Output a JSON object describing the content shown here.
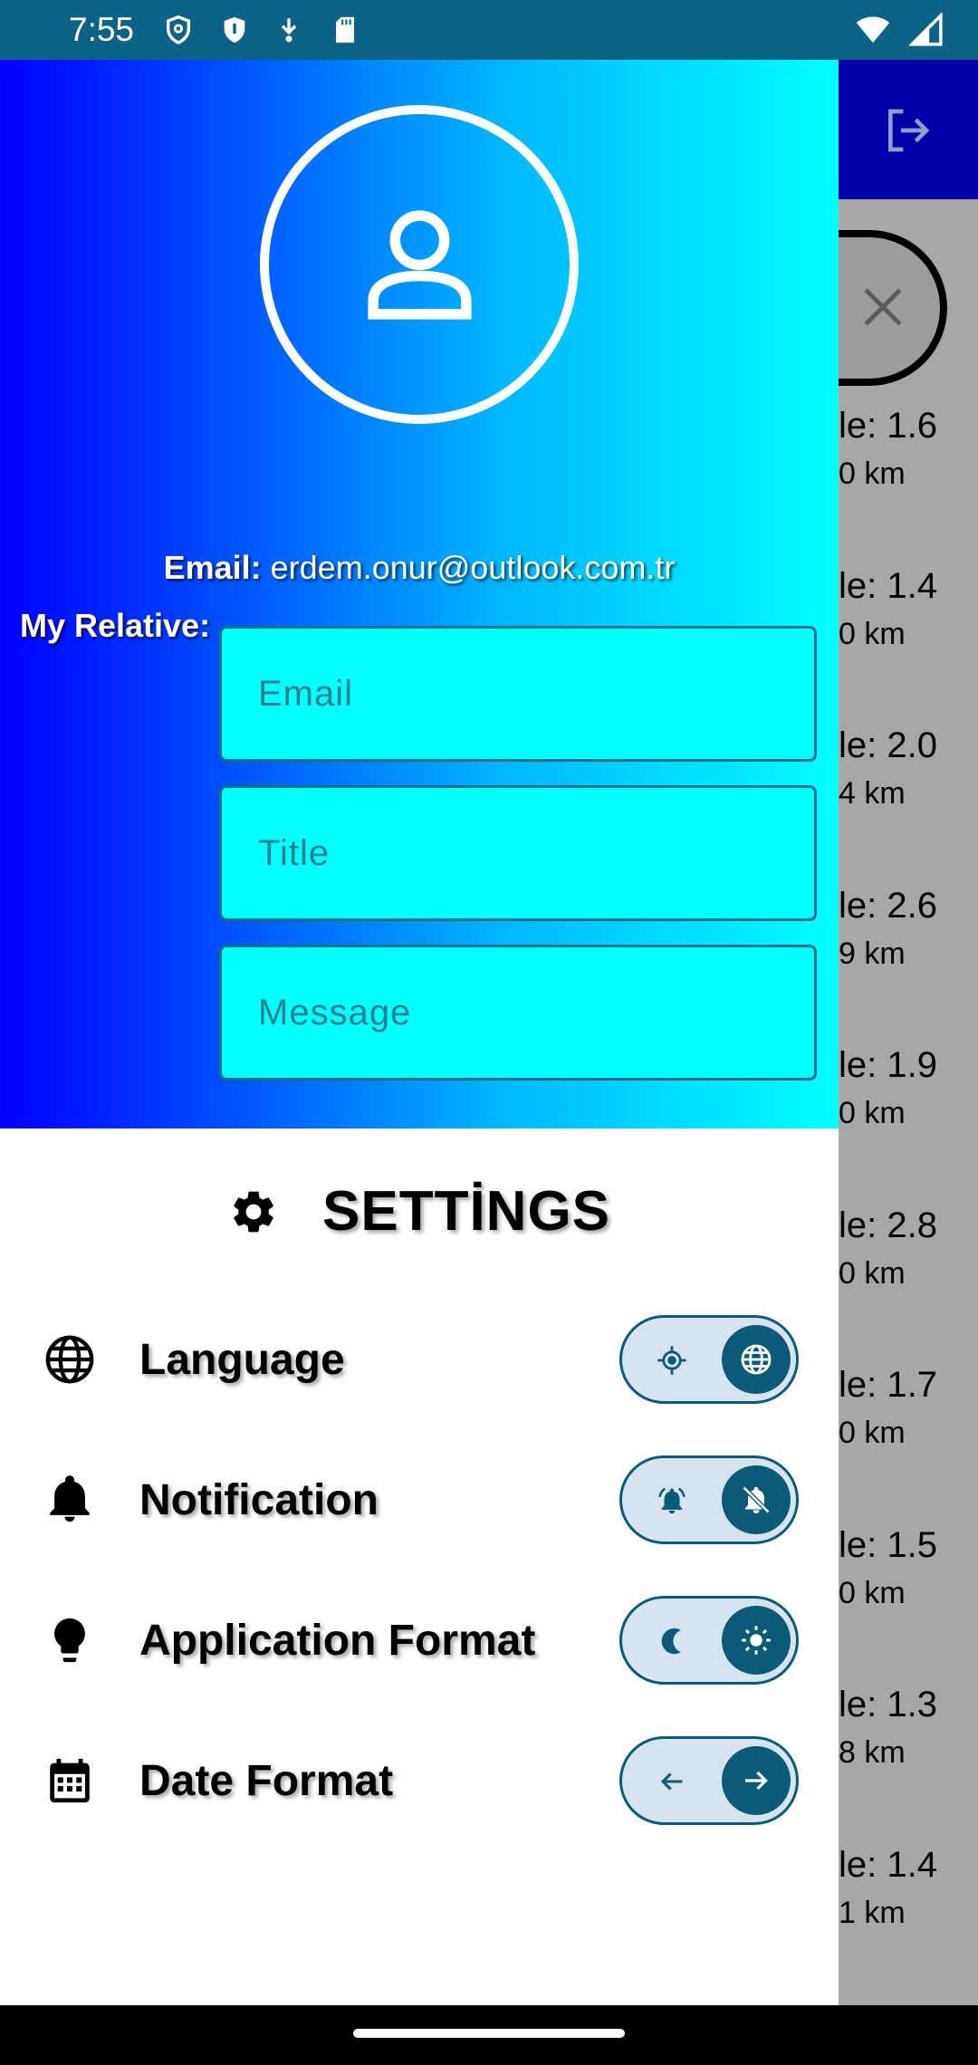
{
  "status_bar": {
    "time": "7:55",
    "icons": [
      "shield-outline-icon",
      "shield-icon",
      "download-icon",
      "sd-card-icon"
    ],
    "right_icons": [
      "wifi-icon",
      "cell-signal-icon"
    ]
  },
  "drawer": {
    "email_label": "Email:",
    "email_value": "erdem.onur@outlook.com.tr",
    "relative_label": "My Relative:",
    "fields": {
      "email_placeholder": "Email",
      "title_placeholder": "Title",
      "message_placeholder": "Message"
    }
  },
  "settings": {
    "title": "SETTİNGS",
    "rows": [
      {
        "label": "Language",
        "icon": "globe-icon",
        "left_icon": "gps-icon",
        "knob_icon": "globe-icon"
      },
      {
        "label": "Notification",
        "icon": "bell-icon",
        "left_icon": "bell-ring-icon",
        "knob_icon": "bell-off-icon"
      },
      {
        "label": "Application Format",
        "icon": "lightbulb-icon",
        "left_icon": "moon-icon",
        "knob_icon": "sun-icon"
      },
      {
        "label": "Date Format",
        "icon": "calendar-icon",
        "left_icon": "arrow-left-icon",
        "knob_icon": "arrow-right-icon"
      }
    ]
  },
  "background_list": {
    "items": [
      {
        "line1": "le: 1.6",
        "line2": "0 km"
      },
      {
        "line1": "le: 1.4",
        "line2": "0 km"
      },
      {
        "line1": "le: 2.0",
        "line2": "4 km"
      },
      {
        "line1": "le: 2.6",
        "line2": "9 km"
      },
      {
        "line1": "le: 1.9",
        "line2": "0 km"
      },
      {
        "line1": "le: 2.8",
        "line2": "0 km"
      },
      {
        "line1": "le: 1.7",
        "line2": "0 km"
      },
      {
        "line1": "le: 1.5",
        "line2": "0 km"
      },
      {
        "line1": "le: 1.3",
        "line2": "8 km"
      },
      {
        "line1": "le: 1.4",
        "line2": "1 km"
      }
    ]
  },
  "colors": {
    "status_bar": "#0d6386",
    "header_gradient_start": "#0000ff",
    "header_gradient_end": "#00ffff",
    "field_bg": "#00ffff",
    "toggle_knob": "#0b5a78",
    "toggle_track": "#d6e4f2",
    "app_bar": "#0000aa"
  }
}
